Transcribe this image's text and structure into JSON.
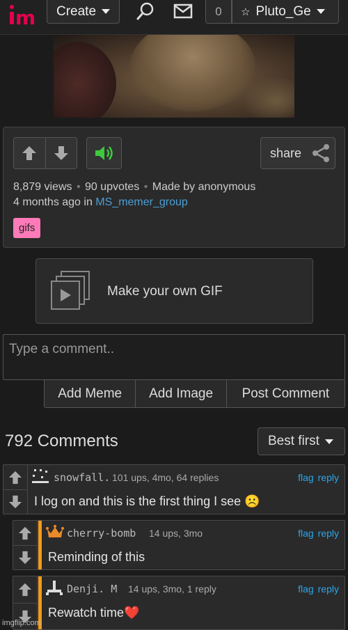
{
  "header": {
    "create_label": "Create",
    "notif_count": "0",
    "username": "Pluto_Ge",
    "logo_color": "#e5004c",
    "icons": [
      "search-icon",
      "mail-icon",
      "star-icon",
      "chevron-down-icon"
    ]
  },
  "post": {
    "views": "8,879 views",
    "upvotes": "90 upvotes",
    "made_by": "Made by anonymous",
    "time_prefix": "4 months ago in ",
    "group": "MS_memer_group",
    "tag": "gifs",
    "share_label": "share",
    "sound_color": "#3ec93e"
  },
  "make_gif": {
    "label": "Make your own GIF"
  },
  "comment_form": {
    "placeholder": "Type a comment..",
    "add_meme": "Add Meme",
    "add_image": "Add Image",
    "post_comment": "Post Comment"
  },
  "comments_header": {
    "count": "792 Comments",
    "sort": "Best first"
  },
  "comments": [
    {
      "user": "snowfall.",
      "meta": "101 ups, 4mo, 64 replies",
      "flag": "flag",
      "reply": "reply",
      "text": "I log on and this is the first thing I see ☹️"
    },
    {
      "user": "cherry-bomb",
      "meta": "14 ups, 3mo",
      "flag": "flag",
      "reply": "reply",
      "text": "Reminding of this"
    },
    {
      "user": "Denji. M",
      "meta": "14 ups, 3mo, 1 reply",
      "flag": "flag",
      "reply": "reply",
      "text": "Rewatch time❤️"
    }
  ],
  "accent_color": "#f39b1b",
  "link_color": "#2aa7ea",
  "watermark": "imgflip.com"
}
